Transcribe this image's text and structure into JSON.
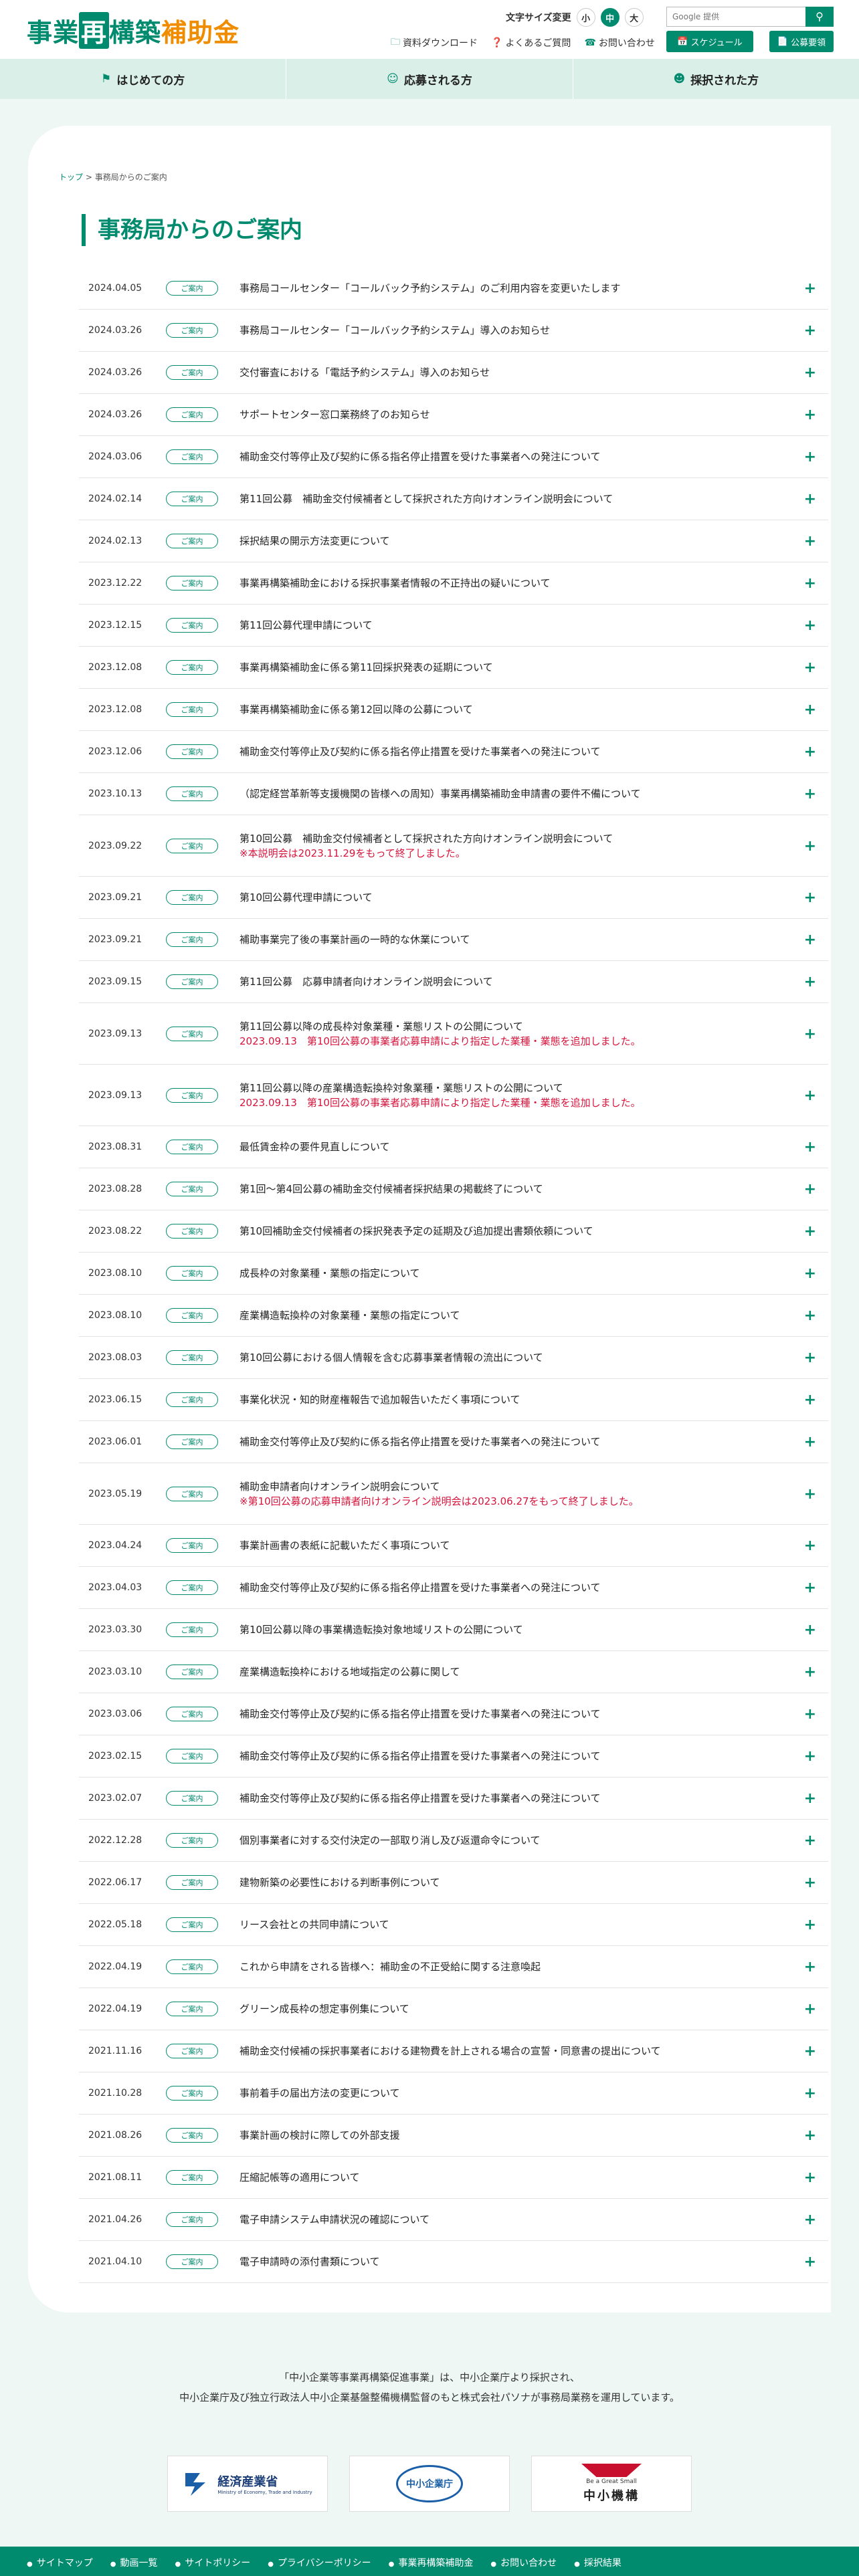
{
  "header": {
    "logo_part1": "事業",
    "logo_part2": "再",
    "logo_part3": "構築",
    "logo_part4": "補助金",
    "fontsize_label": "文字サイズ変更",
    "fontsize_small": "小",
    "fontsize_mid": "中",
    "fontsize_large": "大",
    "search_placeholder": "Google 提供",
    "util_download": "資料ダウンロード",
    "util_faq": "よくあるご質問",
    "util_contact": "お問い合わせ",
    "btn_schedule": "スケジュール",
    "btn_koubo": "公募要領"
  },
  "nav": {
    "beginner": "はじめての方",
    "applicant": "応募される方",
    "adopted": "採択された方"
  },
  "breadcrumb": {
    "top": "トップ",
    "sep": ">",
    "current": "事務局からのご案内"
  },
  "page_title": "事務局からのご案内",
  "news": [
    {
      "date": "2024.04.05",
      "tag": "ご案内",
      "title": "事務局コールセンター「コールバック予約システム」のご利用内容を変更いたします",
      "note": ""
    },
    {
      "date": "2024.03.26",
      "tag": "ご案内",
      "title": "事務局コールセンター「コールバック予約システム」導入のお知らせ",
      "note": ""
    },
    {
      "date": "2024.03.26",
      "tag": "ご案内",
      "title": "交付審査における「電話予約システム」導入のお知らせ",
      "note": ""
    },
    {
      "date": "2024.03.26",
      "tag": "ご案内",
      "title": "サポートセンター窓口業務終了のお知らせ",
      "note": ""
    },
    {
      "date": "2024.03.06",
      "tag": "ご案内",
      "title": "補助金交付等停止及び契約に係る指名停止措置を受けた事業者への発注について",
      "note": ""
    },
    {
      "date": "2024.02.14",
      "tag": "ご案内",
      "title": "第11回公募　補助金交付候補者として採択された方向けオンライン説明会について",
      "note": ""
    },
    {
      "date": "2024.02.13",
      "tag": "ご案内",
      "title": "採択結果の開示方法変更について",
      "note": ""
    },
    {
      "date": "2023.12.22",
      "tag": "ご案内",
      "title": "事業再構築補助金における採択事業者情報の不正持出の疑いについて",
      "note": ""
    },
    {
      "date": "2023.12.15",
      "tag": "ご案内",
      "title": "第11回公募代理申請について",
      "note": ""
    },
    {
      "date": "2023.12.08",
      "tag": "ご案内",
      "title": "事業再構築補助金に係る第11回採択発表の延期について",
      "note": ""
    },
    {
      "date": "2023.12.08",
      "tag": "ご案内",
      "title": "事業再構築補助金に係る第12回以降の公募について",
      "note": ""
    },
    {
      "date": "2023.12.06",
      "tag": "ご案内",
      "title": "補助金交付等停止及び契約に係る指名停止措置を受けた事業者への発注について",
      "note": ""
    },
    {
      "date": "2023.10.13",
      "tag": "ご案内",
      "title": "（認定経営革新等支援機関の皆様への周知）事業再構築補助金申請書の要件不備について",
      "note": ""
    },
    {
      "date": "2023.09.22",
      "tag": "ご案内",
      "title": "第10回公募　補助金交付候補者として採択された方向けオンライン説明会について",
      "note": "※本説明会は2023.11.29をもって終了しました。"
    },
    {
      "date": "2023.09.21",
      "tag": "ご案内",
      "title": "第10回公募代理申請について",
      "note": ""
    },
    {
      "date": "2023.09.21",
      "tag": "ご案内",
      "title": "補助事業完了後の事業計画の一時的な休業について",
      "note": ""
    },
    {
      "date": "2023.09.15",
      "tag": "ご案内",
      "title": "第11回公募　応募申請者向けオンライン説明会について",
      "note": ""
    },
    {
      "date": "2023.09.13",
      "tag": "ご案内",
      "title": "第11回公募以降の成長枠対象業種・業態リストの公開について",
      "note": "2023.09.13　第10回公募の事業者応募申請により指定した業種・業態を追加しました。"
    },
    {
      "date": "2023.09.13",
      "tag": "ご案内",
      "title": "第11回公募以降の産業構造転換枠対象業種・業態リストの公開について",
      "note": "2023.09.13　第10回公募の事業者応募申請により指定した業種・業態を追加しました。"
    },
    {
      "date": "2023.08.31",
      "tag": "ご案内",
      "title": "最低賃金枠の要件見直しについて",
      "note": ""
    },
    {
      "date": "2023.08.28",
      "tag": "ご案内",
      "title": "第1回〜第4回公募の補助金交付候補者採択結果の掲載終了について",
      "note": ""
    },
    {
      "date": "2023.08.22",
      "tag": "ご案内",
      "title": "第10回補助金交付候補者の採択発表予定の延期及び追加提出書類依頼について",
      "note": ""
    },
    {
      "date": "2023.08.10",
      "tag": "ご案内",
      "title": "成長枠の対象業種・業態の指定について",
      "note": ""
    },
    {
      "date": "2023.08.10",
      "tag": "ご案内",
      "title": "産業構造転換枠の対象業種・業態の指定について",
      "note": ""
    },
    {
      "date": "2023.08.03",
      "tag": "ご案内",
      "title": "第10回公募における個人情報を含む応募事業者情報の流出について",
      "note": ""
    },
    {
      "date": "2023.06.15",
      "tag": "ご案内",
      "title": "事業化状況・知的財産権報告で追加報告いただく事項について",
      "note": ""
    },
    {
      "date": "2023.06.01",
      "tag": "ご案内",
      "title": "補助金交付等停止及び契約に係る指名停止措置を受けた事業者への発注について",
      "note": ""
    },
    {
      "date": "2023.05.19",
      "tag": "ご案内",
      "title": "補助金申請者向けオンライン説明会について",
      "note": "※第10回公募の応募申請者向けオンライン説明会は2023.06.27をもって終了しました。"
    },
    {
      "date": "2023.04.24",
      "tag": "ご案内",
      "title": "事業計画書の表紙に記載いただく事項について",
      "note": ""
    },
    {
      "date": "2023.04.03",
      "tag": "ご案内",
      "title": "補助金交付等停止及び契約に係る指名停止措置を受けた事業者への発注について",
      "note": ""
    },
    {
      "date": "2023.03.30",
      "tag": "ご案内",
      "title": "第10回公募以降の事業構造転換対象地域リストの公開について",
      "note": ""
    },
    {
      "date": "2023.03.10",
      "tag": "ご案内",
      "title": "産業構造転換枠における地域指定の公募に関して",
      "note": ""
    },
    {
      "date": "2023.03.06",
      "tag": "ご案内",
      "title": "補助金交付等停止及び契約に係る指名停止措置を受けた事業者への発注について",
      "note": ""
    },
    {
      "date": "2023.02.15",
      "tag": "ご案内",
      "title": "補助金交付等停止及び契約に係る指名停止措置を受けた事業者への発注について",
      "note": ""
    },
    {
      "date": "2023.02.07",
      "tag": "ご案内",
      "title": "補助金交付等停止及び契約に係る指名停止措置を受けた事業者への発注について",
      "note": ""
    },
    {
      "date": "2022.12.28",
      "tag": "ご案内",
      "title": "個別事業者に対する交付決定の一部取り消し及び返還命令について",
      "note": ""
    },
    {
      "date": "2022.06.17",
      "tag": "ご案内",
      "title": "建物新築の必要性における判断事例について",
      "note": ""
    },
    {
      "date": "2022.05.18",
      "tag": "ご案内",
      "title": "リース会社との共同申請について",
      "note": ""
    },
    {
      "date": "2022.04.19",
      "tag": "ご案内",
      "title": "これから申請をされる皆様へ：補助金の不正受給に関する注意喚起",
      "note": ""
    },
    {
      "date": "2022.04.19",
      "tag": "ご案内",
      "title": "グリーン成長枠の想定事例集について",
      "note": ""
    },
    {
      "date": "2021.11.16",
      "tag": "ご案内",
      "title": "補助金交付候補の採択事業者における建物費を計上される場合の宣誓・同意書の提出について",
      "note": ""
    },
    {
      "date": "2021.10.28",
      "tag": "ご案内",
      "title": "事前着手の届出方法の変更について",
      "note": ""
    },
    {
      "date": "2021.08.26",
      "tag": "ご案内",
      "title": "事業計画の検討に際しての外部支援",
      "note": ""
    },
    {
      "date": "2021.08.11",
      "tag": "ご案内",
      "title": "圧縮記帳等の適用について",
      "note": ""
    },
    {
      "date": "2021.04.26",
      "tag": "ご案内",
      "title": "電子申請システム申請状況の確認について",
      "note": ""
    },
    {
      "date": "2021.04.10",
      "tag": "ご案内",
      "title": "電子申請時の添付書類について",
      "note": ""
    }
  ],
  "footer": {
    "line1": "「中小企業等事業再構築促進事業」は、中小企業庁より採択され、",
    "line2": "中小企業庁及び独立行政法人中小企業基盤整備機構監督のもと株式会社パソナが事務局業務を運用しています。",
    "logo_meti": "経済産業省",
    "logo_meti_en": "Ministry of Economy, Trade and Industry",
    "logo_chusho": "中小企業庁",
    "logo_smrj_en": "Be a Great Small",
    "logo_smrj": "中小機構",
    "nav": [
      "サイトマップ",
      "動画一覧",
      "サイトポリシー",
      "プライバシーポリシー",
      "事業再構築補助金",
      "お問い合わせ",
      "採択結果"
    ]
  }
}
